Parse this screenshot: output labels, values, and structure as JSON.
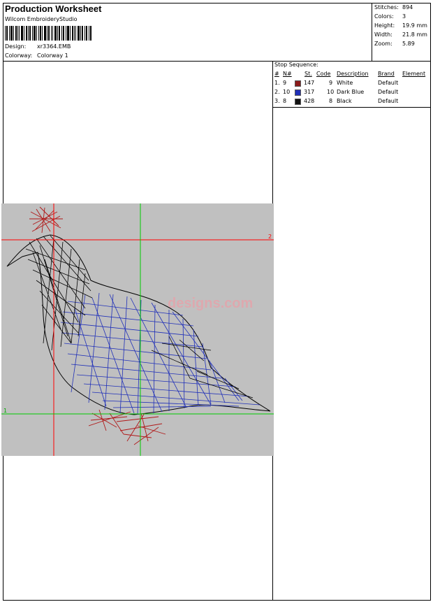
{
  "header": {
    "title": "Production Worksheet",
    "software": "Wilcom  EmbroideryStudio",
    "design_label": "Design:",
    "design_value": "xr3364.EMB",
    "colorway_label": "Colorway:",
    "colorway_value": "Colorway 1"
  },
  "stats": [
    {
      "label": "Stitches:",
      "value": "894"
    },
    {
      "label": "Colors:",
      "value": "3"
    },
    {
      "label": "Height:",
      "value": "19.9 mm"
    },
    {
      "label": "Width:",
      "value": "21.8 mm"
    },
    {
      "label": "Zoom:",
      "value": "5.89"
    }
  ],
  "stop_sequence": {
    "title": "Stop Sequence:",
    "headers": {
      "num": "#",
      "n": "N#",
      "st": "St.",
      "code": "Code",
      "desc": "Description",
      "brand": "Brand",
      "element": "Element"
    },
    "rows": [
      {
        "num": "1.",
        "n": "9",
        "color": "#8b1a1a",
        "st": "147",
        "code": "9",
        "desc": "White",
        "brand": "Default"
      },
      {
        "num": "2.",
        "n": "10",
        "color": "#1f2fb8",
        "st": "317",
        "code": "10",
        "desc": "Dark Blue",
        "brand": "Default"
      },
      {
        "num": "3.",
        "n": "8",
        "color": "#111111",
        "st": "428",
        "code": "8",
        "desc": "Black",
        "brand": "Default"
      }
    ]
  },
  "preview": {
    "watermark": "designs.com",
    "axis_label_x": "2",
    "axis_label_y": "1",
    "colors": {
      "background": "#c0c0c0",
      "red_guide": "#ff0000",
      "green_guide": "#00cc00",
      "outline": "#000000",
      "fill_stitch": "#1f2fb8",
      "accent_stitch": "#b01818"
    }
  }
}
